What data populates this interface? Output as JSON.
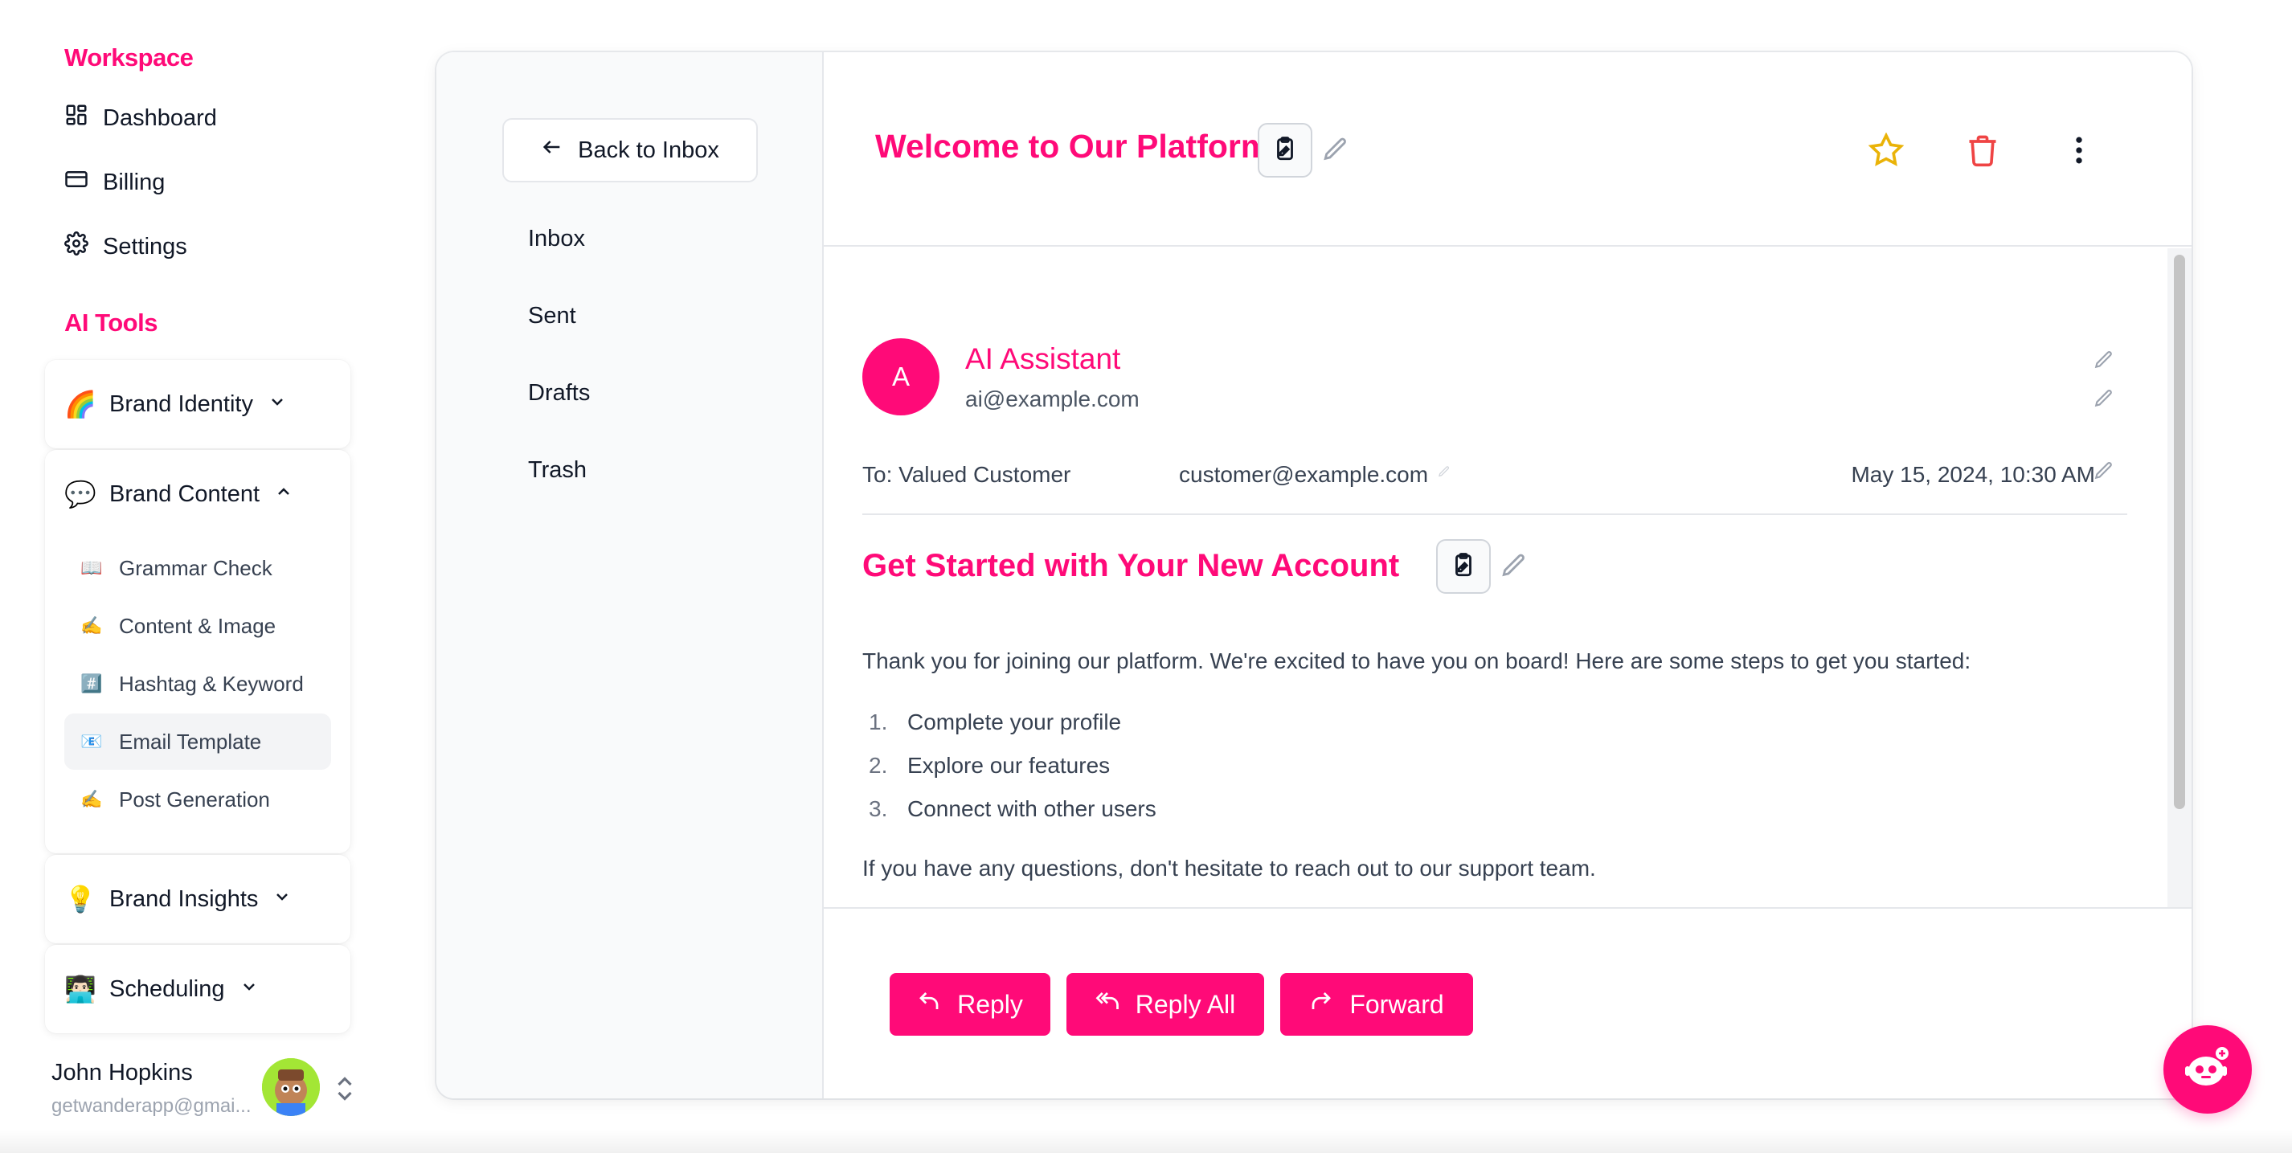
{
  "colors": {
    "accent": "#ff0a78",
    "star": "#eab308",
    "trash": "#ef4444"
  },
  "sidebar": {
    "workspace_title": "Workspace",
    "workspace_items": [
      {
        "label": "Dashboard",
        "icon": "dashboard-icon"
      },
      {
        "label": "Billing",
        "icon": "credit-card-icon"
      },
      {
        "label": "Settings",
        "icon": "gear-icon"
      }
    ],
    "ai_tools_title": "AI Tools",
    "groups": [
      {
        "emoji": "🌈",
        "label": "Brand Identity",
        "expanded": false
      },
      {
        "emoji": "💬",
        "label": "Brand Content",
        "expanded": true,
        "items": [
          {
            "emoji": "📖",
            "label": "Grammar Check"
          },
          {
            "emoji": "✍️",
            "label": "Content & Image"
          },
          {
            "emoji": "#️⃣",
            "label": "Hashtag & Keyword"
          },
          {
            "emoji": "📧",
            "label": "Email Template",
            "active": true
          },
          {
            "emoji": "✍️",
            "label": "Post Generation"
          }
        ]
      },
      {
        "emoji": "💡",
        "label": "Brand Insights",
        "expanded": false
      },
      {
        "emoji": "👨🏻‍💻",
        "label": "Scheduling",
        "expanded": false
      }
    ],
    "user": {
      "name": "John Hopkins",
      "email": "getwanderapp@gmai..."
    }
  },
  "folders": {
    "back_label": "Back to Inbox",
    "items": [
      "Inbox",
      "Sent",
      "Drafts",
      "Trash"
    ]
  },
  "email": {
    "title": "Welcome to Our Platform",
    "sender_initial": "A",
    "sender_name": "AI Assistant",
    "sender_email": "ai@example.com",
    "to_label": "To: Valued Customer",
    "to_email": "customer@example.com",
    "date": "May 15, 2024, 10:30 AM",
    "subject": "Get Started with Your New Account",
    "intro": "Thank you for joining our platform. We're excited to have you on board! Here are some steps to get you started:",
    "steps": [
      {
        "num": "1.",
        "text": "Complete your profile"
      },
      {
        "num": "2.",
        "text": "Explore our features"
      },
      {
        "num": "3.",
        "text": "Connect with other users"
      }
    ],
    "outro": "If you have any questions, don't hesitate to reach out to our support team."
  },
  "actions": {
    "reply": "Reply",
    "reply_all": "Reply All",
    "forward": "Forward"
  }
}
